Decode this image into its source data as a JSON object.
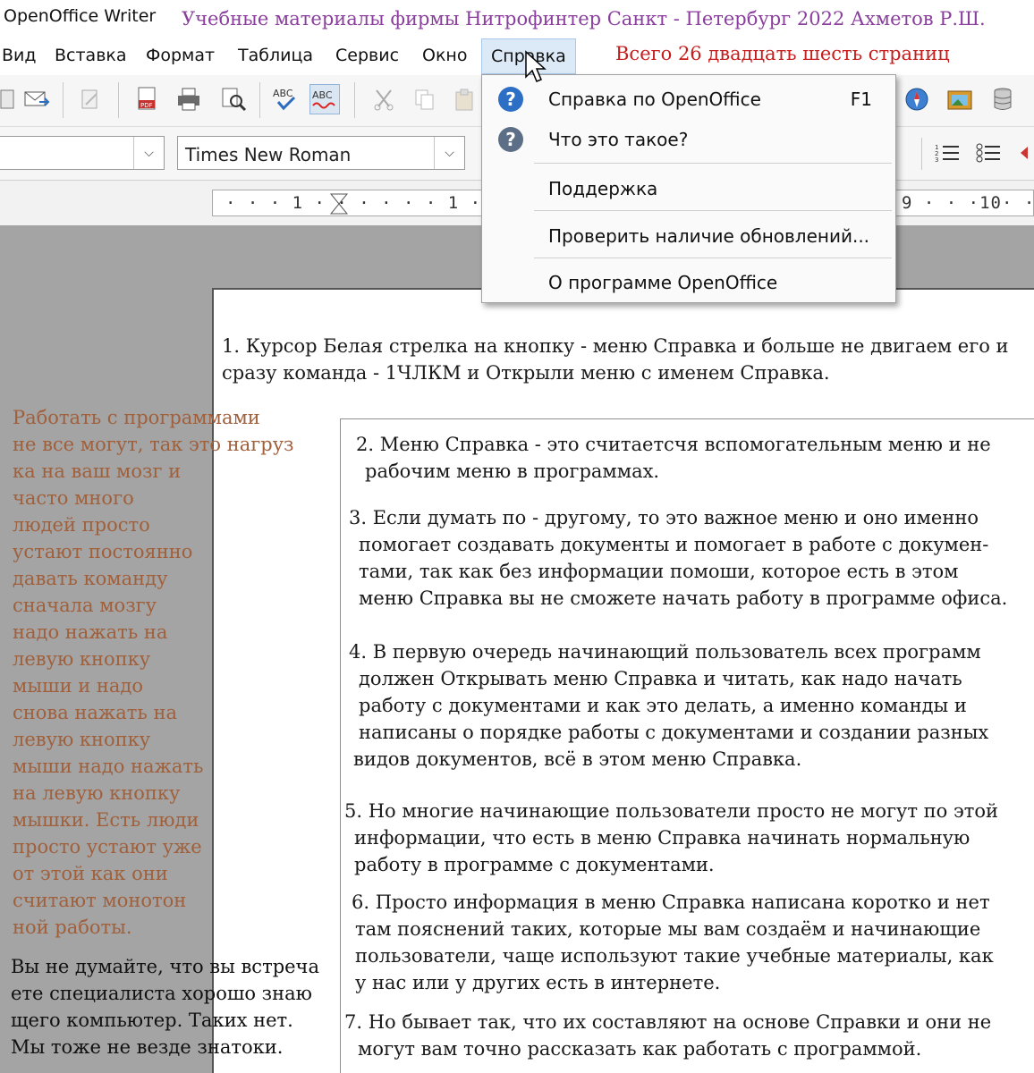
{
  "window": {
    "app_title": "OpenOffice Writer",
    "note_header": "Учебные материалы фирмы Нитрофинтер  Санкт - Петербург 2022  Ахметов Р.Ш."
  },
  "menubar": {
    "items": [
      "Вид",
      "Вставка",
      "Формат",
      "Таблица",
      "Сервис",
      "Окно",
      "Справка"
    ],
    "pages_note": "Всего 26 двадцать шесть страниц"
  },
  "formatting": {
    "font_name": "Times New Roman"
  },
  "ruler": {
    "left_marks": "· · · 1 · · ·   · · · 1 · · · 2",
    "right_marks": "9 · · ·10· · ·"
  },
  "help_menu": {
    "items": [
      {
        "label": "Справка по OpenOffice",
        "shortcut": "F1",
        "icon": "help-icon"
      },
      {
        "label": "Что это такое?",
        "shortcut": "",
        "icon": "whats-this-icon"
      },
      {
        "label": "Поддержка",
        "shortcut": "",
        "icon": ""
      },
      {
        "label": "Проверить наличие обновлений...",
        "shortcut": "",
        "icon": ""
      },
      {
        "label": "О программе OpenOffice",
        "shortcut": "",
        "icon": ""
      }
    ]
  },
  "document": {
    "p1": [
      "1. Курсор Белая стрелка на кнопку - меню Справка и больше не двигаем его и",
      "сразу команда - 1ЧЛКМ и Открыли меню с именем Справка."
    ],
    "p2": [
      "2. Меню Справка - это считаетсчя вспомогательным меню и не",
      "рабочим меню в программах."
    ],
    "p3": [
      "3. Если думать по - другому, то это важное меню и оно именно",
      "помогает создавать документы и помогает в работе с докумен-",
      "тами, так как без информации помоши, которое есть в этом",
      "меню Справка вы не сможете начать работу в программе офиса."
    ],
    "p4": [
      "4. В первую очередь начинающий пользователь всех программ",
      "должен Открывать меню Справка и читать, как надо начать",
      "работу с документами и как это делать, а именно команды и",
      "написаны о порядке работы с документами и создании разных",
      "видов документов, всё в этом меню Справка."
    ],
    "p5": [
      "5. Но многие начинающие пользователи просто не могут по этой",
      "информации, что есть в меню Справка начинать нормальную",
      "работу в программе с документами."
    ],
    "p6": [
      "6. Просто информация в меню Справка написана коротко и нет",
      "там пояснений таких, которые мы вам создаём и начинающие",
      "пользователи, чаще используют такие учебные материалы, как",
      "у нас или у других есть в интернете."
    ],
    "p7": [
      "7. Но бывает так, что их составляют на основе Справки и они не",
      "могут вам точно рассказать как работать с программой."
    ]
  },
  "side_note": [
    "Работать с программами",
    "   не все могут, так  это нагруз",
    "ка на ваш мозг и",
    " часто много",
    " людей просто",
    " устают постоянно",
    " давать команду",
    " сначала мозгу",
    " надо нажать на",
    " левую кнопку",
    " мыши и надо",
    " снова нажать на",
    " левую кнопку",
    " мыши надо нажать",
    " на левую кнопку",
    " мышки. Есть люди",
    " просто устают уже",
    " от этой как они",
    " считают монотон",
    " ной работы."
  ],
  "bottom_note": [
    "Вы не думайте, что вы встреча",
    " ете специалиста хорошо знаю",
    " щего компьютер.      Таких нет.",
    "   Мы тоже не везде  знатоки."
  ]
}
